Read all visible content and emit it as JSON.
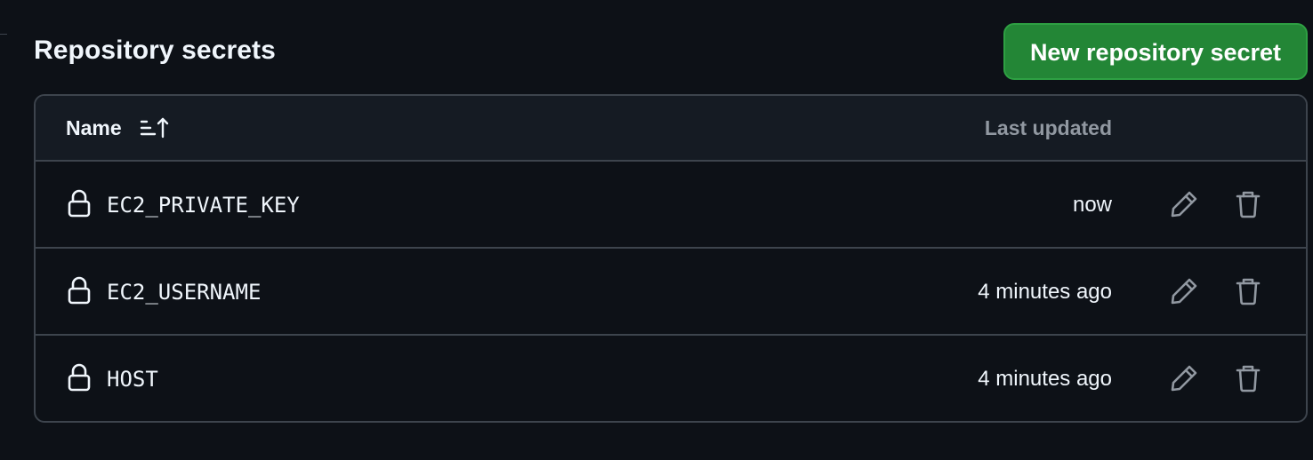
{
  "section": {
    "title": "Repository secrets",
    "new_button_label": "New repository secret"
  },
  "table": {
    "columns": {
      "name": "Name",
      "last_updated": "Last updated"
    },
    "rows": [
      {
        "name": "EC2_PRIVATE_KEY",
        "updated": "now"
      },
      {
        "name": "EC2_USERNAME",
        "updated": "4 minutes ago"
      },
      {
        "name": "HOST",
        "updated": "4 minutes ago"
      }
    ]
  },
  "icons": {
    "sort": "sort-ascending-icon",
    "lock": "lock-icon",
    "edit": "pencil-icon",
    "delete": "trash-icon"
  },
  "colors": {
    "background": "#0d1117",
    "header_background": "#151b23",
    "border": "#3d444d",
    "primary_button": "#238636",
    "primary_button_border": "#2ea043",
    "muted_text": "#9198a1",
    "action_icon": "#9198a1"
  }
}
